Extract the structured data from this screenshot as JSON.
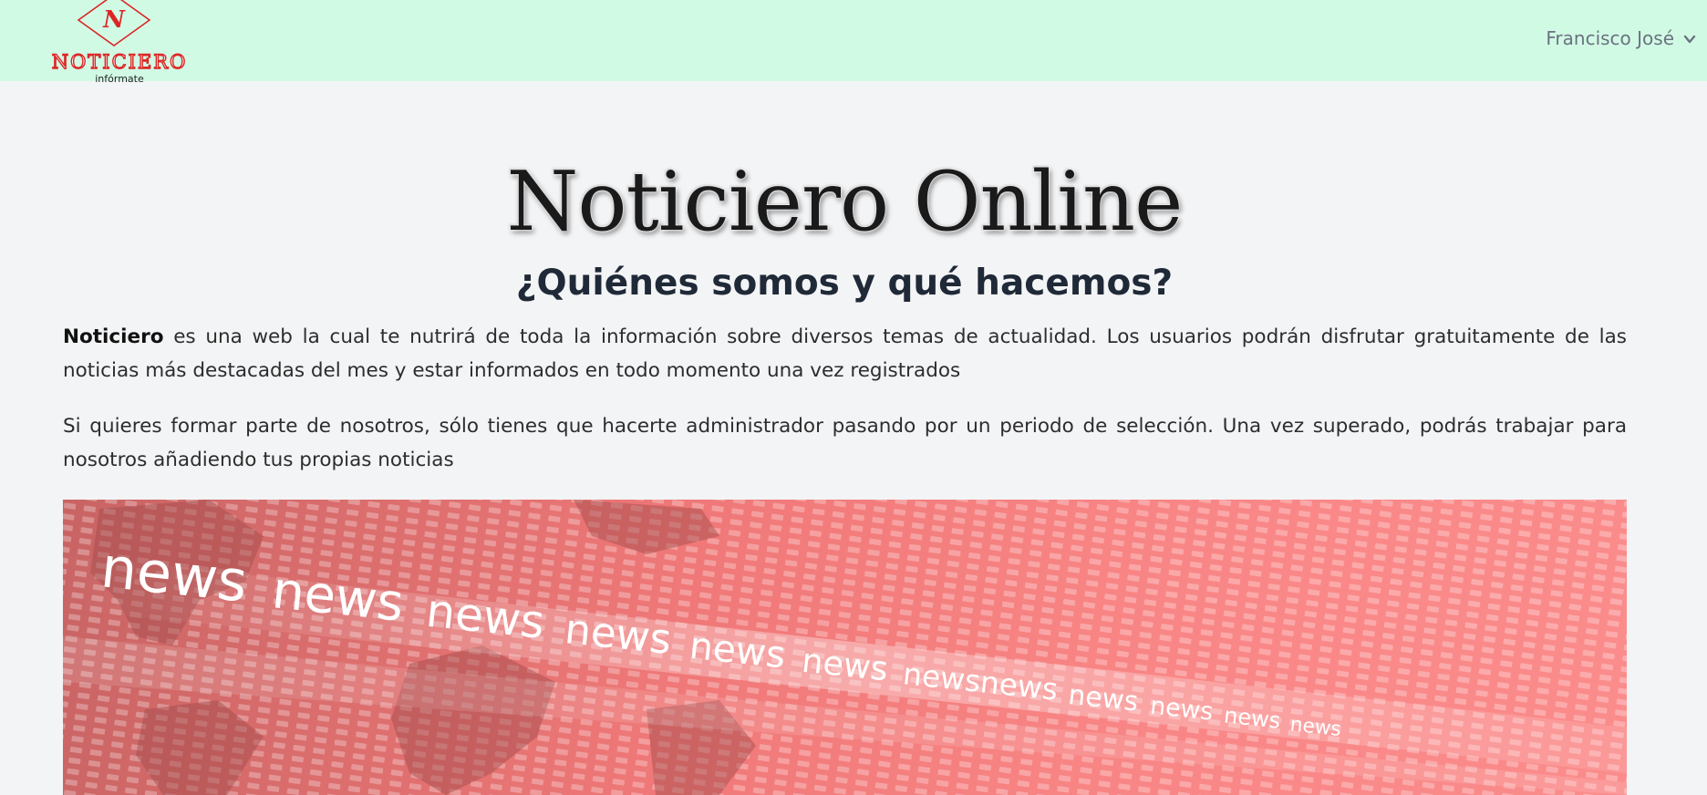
{
  "navbar": {
    "logo": {
      "brand": "NOTICIERO",
      "tagline": "infórmate",
      "mark": "N"
    },
    "user_name": "Francisco José",
    "chevron_icon": "chevron-down-icon"
  },
  "hero": {
    "title": "Noticiero Online",
    "subtitle": "¿Quiénes somos y qué hacemos?"
  },
  "intro": {
    "brand_bold": "Noticiero",
    "paragraph_1_rest": " es una web la cual te nutrirá de toda la información sobre diversos temas de actualidad. Los usuarios podrán disfrutar gratuitamente de las noticias más destacadas del mes y estar informados en todo momento una vez registrados",
    "paragraph_2": "Si quieres formar parte de nosotros, sólo tienes que hacerte administrador pasando por un periodo de selección. Una vez superado, podrás trabajar para nosotros añadiendo tus propias noticias"
  },
  "banner": {
    "words": [
      "news",
      "news",
      "news",
      "news",
      "news",
      "news",
      "newsnews",
      "news",
      "news",
      "news",
      "news"
    ]
  },
  "colors": {
    "navbar_bg": "#d1fae5",
    "page_bg": "#f3f4f6",
    "logo_red": "#dc2626",
    "banner_red": "#f07878"
  }
}
